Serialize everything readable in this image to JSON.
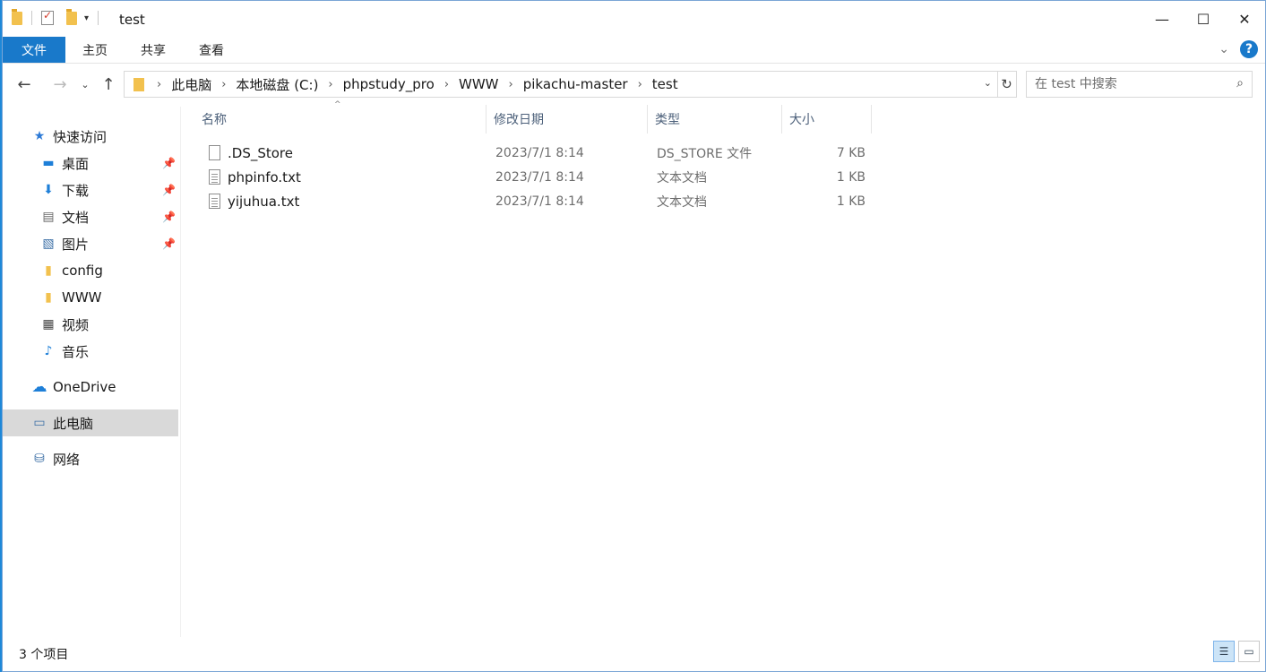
{
  "window": {
    "title": "test"
  },
  "window_controls": {
    "minimize": "—",
    "maximize": "☐",
    "close": "✕"
  },
  "ribbon": {
    "tabs": [
      "文件",
      "主页",
      "共享",
      "查看"
    ],
    "expand_glyph": "⌄",
    "help_label": "?"
  },
  "nav": {
    "back": "←",
    "forward": "→",
    "recent": "⌄",
    "up": "↑",
    "breadcrumb": [
      "此电脑",
      "本地磁盘 (C:)",
      "phpstudy_pro",
      "WWW",
      "pikachu-master",
      "test"
    ],
    "breadcrumb_sep": "›",
    "refresh": "↻",
    "address_dropdown": "⌄"
  },
  "search": {
    "placeholder": "在 test 中搜索",
    "icon": "⌕"
  },
  "sidebar": {
    "items": [
      {
        "label": "快速访问",
        "icon": "star-icon",
        "glyph": "★",
        "color": "#2d7ad6"
      },
      {
        "label": "桌面",
        "icon": "desktop-icon",
        "glyph": "▬",
        "color": "#1e7fd8",
        "pinned": true
      },
      {
        "label": "下载",
        "icon": "download-icon",
        "glyph": "⬇",
        "color": "#1e7fd8",
        "pinned": true
      },
      {
        "label": "文档",
        "icon": "document-icon",
        "glyph": "▤",
        "color": "#666666",
        "pinned": true
      },
      {
        "label": "图片",
        "icon": "pictures-icon",
        "glyph": "▧",
        "color": "#3a6ea5",
        "pinned": true
      },
      {
        "label": "config",
        "icon": "folder-icon",
        "glyph": "▮",
        "color": "#f2c14e"
      },
      {
        "label": "WWW",
        "icon": "folder-icon",
        "glyph": "▮",
        "color": "#f2c14e"
      },
      {
        "label": "视频",
        "icon": "video-icon",
        "glyph": "▦",
        "color": "#444444"
      },
      {
        "label": "音乐",
        "icon": "music-icon",
        "glyph": "♪",
        "color": "#1e7fd8"
      },
      {
        "label": "OneDrive",
        "icon": "cloud-icon",
        "glyph": "☁",
        "color": "#1e7fd8"
      },
      {
        "label": "此电脑",
        "icon": "computer-icon",
        "glyph": "▭",
        "color": "#3a6ea5",
        "selected": true
      },
      {
        "label": "网络",
        "icon": "network-icon",
        "glyph": "⛁",
        "color": "#3a6ea5"
      }
    ],
    "pin_glyph": "📌"
  },
  "columns": {
    "name": "名称",
    "date": "修改日期",
    "type": "类型",
    "size": "大小",
    "sort_glyph": "^"
  },
  "files": [
    {
      "name": ".DS_Store",
      "date": "2023/7/1 8:14",
      "type": "DS_STORE 文件",
      "size": "7 KB",
      "icon": "generic-file"
    },
    {
      "name": "phpinfo.txt",
      "date": "2023/7/1 8:14",
      "type": "文本文档",
      "size": "1 KB",
      "icon": "text-file"
    },
    {
      "name": "yijuhua.txt",
      "date": "2023/7/1 8:14",
      "type": "文本文档",
      "size": "1 KB",
      "icon": "text-file"
    }
  ],
  "status": {
    "item_count": "3 个项目"
  },
  "view_buttons": {
    "details": "☰",
    "large_icons": "▭"
  }
}
